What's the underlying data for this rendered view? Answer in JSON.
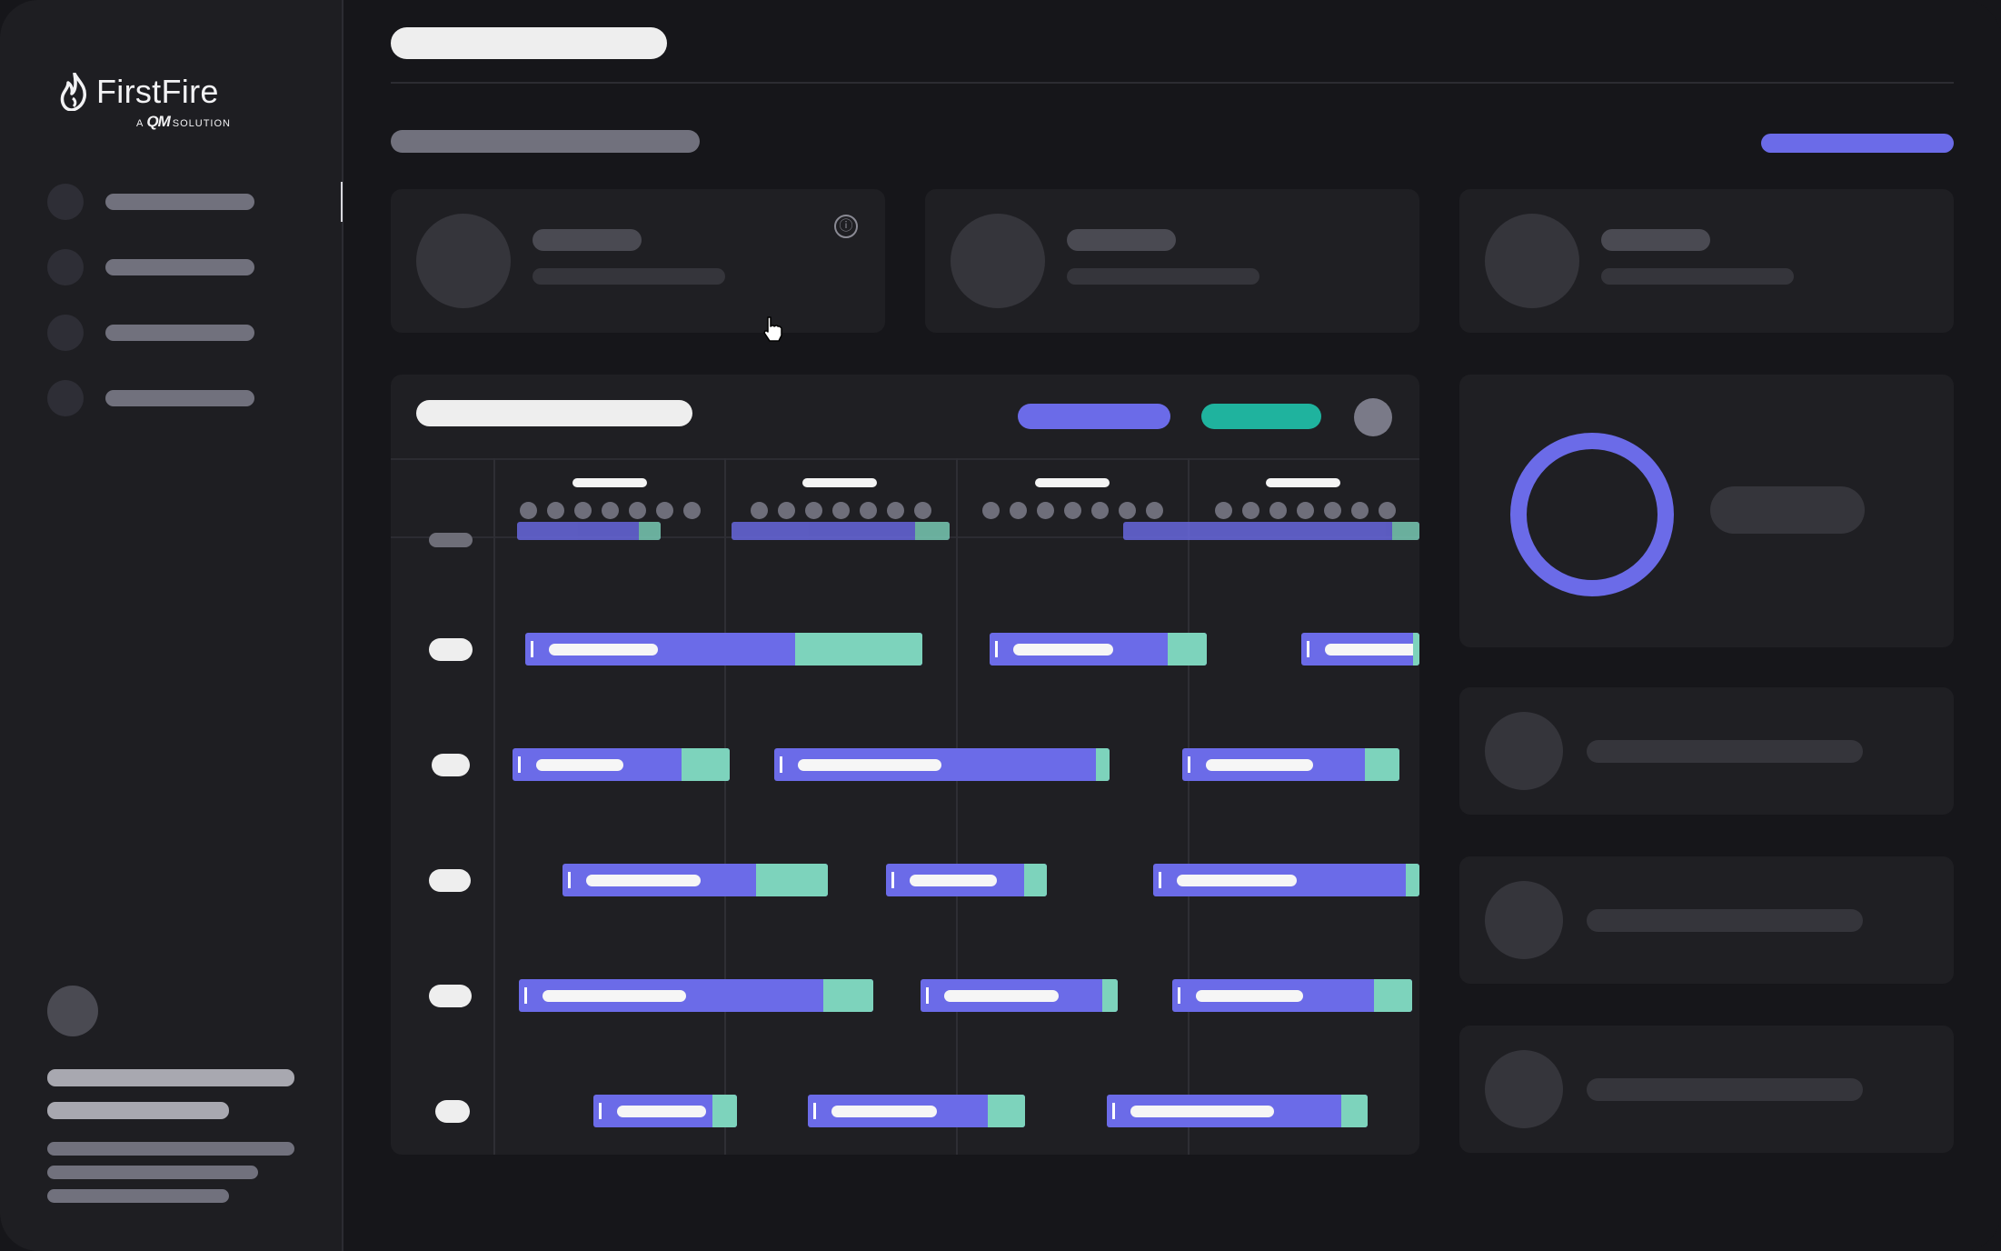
{
  "brand": {
    "name": "FirstFire",
    "tagline_prefix": "A",
    "tagline_mark": "QM",
    "tagline_suffix": "SOLUTION"
  },
  "header": {
    "info_icon": "ⓘ"
  },
  "colors": {
    "accent": "#6b6be8",
    "accent_secondary": "#1fb39e",
    "task_remainder": "#7dd3bc",
    "background": "#16161a",
    "panel": "#1f1f23"
  },
  "icons": [
    "flame-logo-icon",
    "info-icon",
    "hand-cursor-icon"
  ],
  "gantt": {
    "rows": [
      {
        "tasks": [
          {
            "filled": 0.68
          },
          {
            "filled": 0.82
          },
          {
            "filled": 0.95
          }
        ]
      },
      {
        "tasks": [
          {
            "filled": 0.78
          },
          {
            "filled": 0.96
          },
          {
            "filled": 0.84
          }
        ]
      },
      {
        "tasks": [
          {
            "filled": 0.73
          },
          {
            "filled": 0.86
          },
          {
            "filled": 0.95
          }
        ]
      },
      {
        "tasks": [
          {
            "filled": 0.86
          },
          {
            "filled": 0.92
          },
          {
            "filled": 0.84
          }
        ]
      },
      {
        "tasks": [
          {
            "filled": 0.83
          },
          {
            "filled": 0.83
          },
          {
            "filled": 0.9
          }
        ]
      }
    ]
  }
}
